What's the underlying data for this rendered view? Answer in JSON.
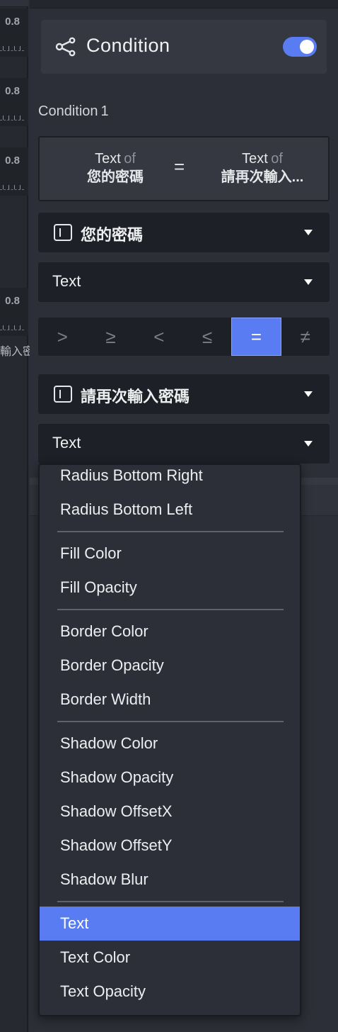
{
  "left_strip": {
    "rows": [
      {
        "value": "0.8"
      },
      {
        "value": "0.8"
      },
      {
        "value": "0.8"
      },
      {
        "value": "0.8"
      }
    ],
    "partial_label": "輸入密"
  },
  "condition_header": {
    "icon": "share-icon",
    "title": "Condition",
    "toggle_on": true,
    "accent_color": "#5a7cf2"
  },
  "condition": {
    "label": "Condition",
    "number": "1",
    "summary": {
      "left_kind": "Text",
      "left_of": "of",
      "left_name": "您的密碼",
      "operator": "=",
      "right_kind": "Text",
      "right_of": "of",
      "right_name": "請再次輸入..."
    }
  },
  "left_operand": {
    "element": "您的密碼",
    "property": "Text"
  },
  "operators": [
    ">",
    "≥",
    "<",
    "≤",
    "=",
    "≠"
  ],
  "active_operator": "=",
  "right_operand": {
    "element": "請再次輸入密碼",
    "property": "Text"
  },
  "property_menu": {
    "groups": [
      [
        "Radius Bottom Right",
        "Radius Bottom Left"
      ],
      [
        "Fill Color",
        "Fill Opacity"
      ],
      [
        "Border Color",
        "Border Opacity",
        "Border Width"
      ],
      [
        "Shadow Color",
        "Shadow Opacity",
        "Shadow OffsetX",
        "Shadow OffsetY",
        "Shadow Blur"
      ],
      [
        "Text",
        "Text Color",
        "Text Opacity"
      ]
    ],
    "selected": "Text"
  }
}
